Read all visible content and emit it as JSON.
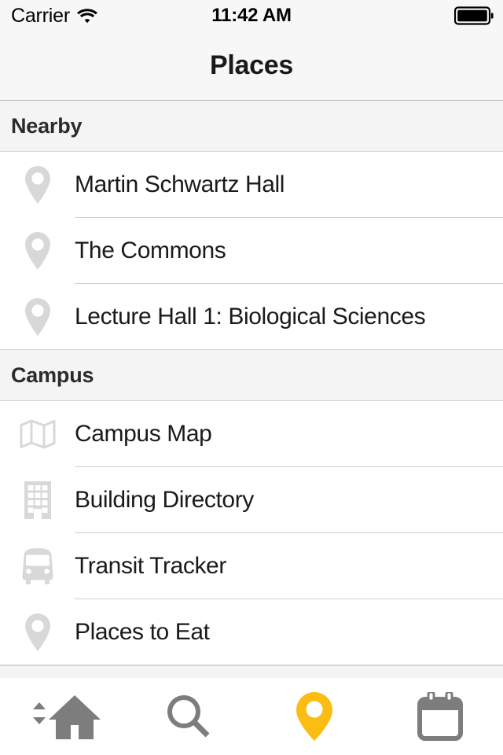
{
  "status_bar": {
    "carrier": "Carrier",
    "wifi_icon": "wifi-icon",
    "time": "11:42 AM",
    "battery_icon": "battery-full-icon"
  },
  "nav_bar": {
    "title": "Places"
  },
  "colors": {
    "accent": "#fbbc13",
    "tab_inactive": "#7d7d7d",
    "row_icon": "#d8d8d8",
    "separator": "#cfcfcf",
    "header_bg": "#f4f4f4",
    "text": "#1a1a1a"
  },
  "sections": [
    {
      "title": "Nearby",
      "rows": [
        {
          "label": "Martin Schwartz Hall",
          "icon": "map-pin-icon"
        },
        {
          "label": "The Commons",
          "icon": "map-pin-icon"
        },
        {
          "label": "Lecture Hall 1: Biological Sciences",
          "icon": "map-pin-icon"
        }
      ]
    },
    {
      "title": "Campus",
      "rows": [
        {
          "label": "Campus Map",
          "icon": "folded-map-icon"
        },
        {
          "label": "Building Directory",
          "icon": "building-icon"
        },
        {
          "label": "Transit Tracker",
          "icon": "bus-icon"
        },
        {
          "label": "Places to Eat",
          "icon": "map-pin-icon"
        }
      ]
    }
  ],
  "tab_bar": {
    "tabs": [
      {
        "name": "home",
        "icon": "home-selector-icon",
        "active": false
      },
      {
        "name": "search",
        "icon": "search-icon",
        "active": false
      },
      {
        "name": "places",
        "icon": "map-pin-filled-icon",
        "active": true
      },
      {
        "name": "calendar",
        "icon": "calendar-icon",
        "active": false
      }
    ]
  }
}
